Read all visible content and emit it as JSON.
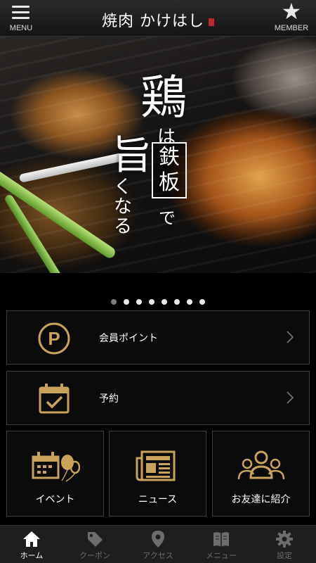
{
  "header": {
    "title": "焼肉 かけはし",
    "menu_label": "MENU",
    "member_label": "MEMBER"
  },
  "hero": {
    "line1_big": "鶏",
    "line1_small": "は",
    "line1_box": "鉄板",
    "line1_after": "で",
    "line2_big": "旨",
    "line2_small": "くなる",
    "slide_count": 8,
    "active_slide": 0
  },
  "cards": [
    {
      "label": "会員ポイント",
      "icon": "points-p-icon"
    },
    {
      "label": "予約",
      "icon": "calendar-check-icon"
    },
    {
      "label": "イベント",
      "icon": "event-calendar-balloon-icon"
    },
    {
      "label": "ニュース",
      "icon": "newspaper-icon"
    },
    {
      "label": "お友達に紹介",
      "icon": "friends-icon"
    }
  ],
  "nav": [
    {
      "label": "ホーム",
      "icon": "home-icon",
      "active": true
    },
    {
      "label": "クーポン",
      "icon": "coupon-tag-icon",
      "active": false
    },
    {
      "label": "アクセス",
      "icon": "map-pin-icon",
      "active": false
    },
    {
      "label": "メニュー",
      "icon": "book-icon",
      "active": false
    },
    {
      "label": "設定",
      "icon": "gear-icon",
      "active": false
    }
  ],
  "colors": {
    "gold": "#c9a35a",
    "nav_active": "#ffffff",
    "nav_inactive": "#6d6d6d",
    "seal_red": "#c0262b"
  }
}
